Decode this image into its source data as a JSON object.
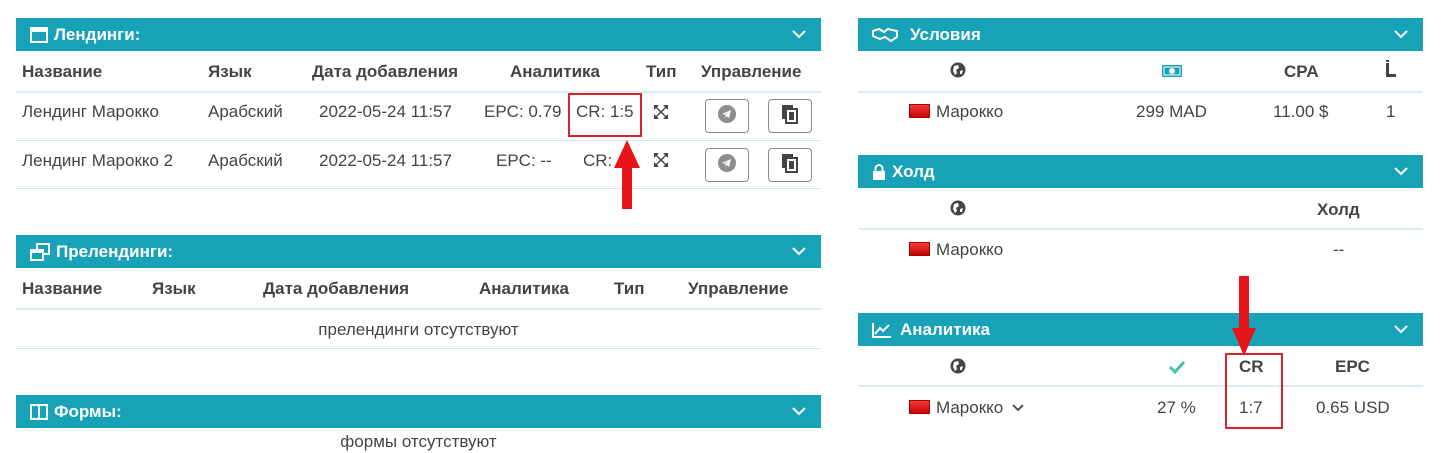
{
  "landings": {
    "title": "Лендинги:",
    "headers": [
      "Название",
      "Язык",
      "Дата добавления",
      "Аналитика",
      "Тип",
      "Управление"
    ],
    "rows": [
      {
        "name": "Лендинг Марокко",
        "lang": "Арабский",
        "date": "2022-05-24 11:57",
        "epc": "EPC: 0.79",
        "cr": "CR: 1:5"
      },
      {
        "name": "Лендинг Марокко 2",
        "lang": "Арабский",
        "date": "2022-05-24 11:57",
        "epc": "EPC: --",
        "cr": "CR: --"
      }
    ]
  },
  "prelandings": {
    "title": "Прелендинги:",
    "headers": [
      "Название",
      "Язык",
      "Дата добавления",
      "Аналитика",
      "Тип",
      "Управление"
    ],
    "empty": "прелендинги отсутствуют"
  },
  "forms": {
    "title": "Формы:",
    "empty": "формы отсутствуют"
  },
  "conditions": {
    "title": "Условия",
    "headers": {
      "cpa": "CPA"
    },
    "row": {
      "country": "Марокко",
      "price": "299 MAD",
      "cpa": "11.00 $",
      "count": "1"
    }
  },
  "hold": {
    "title": "Холд",
    "headers": {
      "hold": "Холд"
    },
    "row": {
      "country": "Марокко",
      "hold": "--"
    }
  },
  "analytics": {
    "title": "Аналитика",
    "headers": {
      "cr": "CR",
      "epc": "EPC"
    },
    "row": {
      "country": "Марокко",
      "approve": "27 %",
      "cr": "1:7",
      "epc": "0.65 USD"
    }
  },
  "colors": {
    "header": "#17a2b8",
    "highlight": "#d8232a",
    "check": "#3cc7a6",
    "flag": "#e01a1a"
  }
}
